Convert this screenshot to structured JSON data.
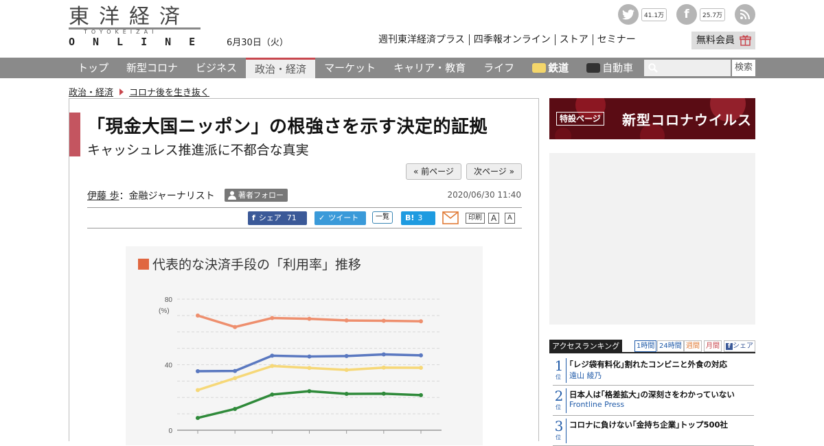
{
  "brand": {
    "logo_kanji": "東洋経済",
    "logo_sub": "TOYOKEIZAI",
    "logo_online": "ONLINE",
    "accent": "#c8474e"
  },
  "header": {
    "date": "6月30日（火）",
    "links": [
      "週刊東洋経済プラス",
      "四季報オンライン",
      "ストア",
      "セミナー"
    ],
    "member_label": "無料会員",
    "social": [
      {
        "icon": "twitter-icon",
        "count": "41.1万"
      },
      {
        "icon": "facebook-icon",
        "count": "25.7万"
      },
      {
        "icon": "rss-icon",
        "count": ""
      }
    ]
  },
  "nav": {
    "items": [
      "トップ",
      "新型コロナ",
      "ビジネス",
      "政治・経済",
      "マーケット",
      "キャリア・教育",
      "ライフ",
      "鉄道",
      "自動車"
    ],
    "active_index": 3,
    "search_placeholder": "",
    "search_button": "検索"
  },
  "breadcrumb": [
    "政治・経済",
    "コロナ後を生き抜く"
  ],
  "article": {
    "title": "「現金大国ニッポン」の根強さを示す決定的証拠",
    "subtitle": "キャッシュレス推進派に不都合な真実",
    "prev_page": "« 前ページ",
    "next_page": "次ページ »",
    "author_name": "伊藤 歩",
    "author_role": "：金融ジャーナリスト",
    "follow_label": "著者フォロー",
    "date": "2020/06/30 11:40",
    "share": {
      "facebook_label": "シェア",
      "facebook_count": "71",
      "tweet_label": "ツイート",
      "list_label": "一覧",
      "hatena_label": "B!",
      "hatena_count": "3",
      "print_label": "印刷",
      "font_large": "A",
      "font_small": "A"
    }
  },
  "chart_data": {
    "type": "line",
    "title": "代表的な決済手段の「利用率」推移",
    "ylabel": "(%)",
    "ylim": [
      0,
      80
    ],
    "yticks": [
      0,
      40,
      80
    ],
    "x_count": 7,
    "grid": true,
    "series": [
      {
        "color": "#ee8f6e",
        "values": [
          70,
          63,
          68.5,
          68,
          67,
          66.8,
          66.5
        ]
      },
      {
        "color": "#5a78c0",
        "values": [
          36,
          36.2,
          45.5,
          45,
          45.3,
          46.3,
          45.7
        ]
      },
      {
        "color": "#f6d878",
        "values": [
          24.5,
          31.8,
          39.2,
          38,
          36.8,
          38.2,
          38.1
        ]
      },
      {
        "color": "#2f8a3a",
        "values": [
          7.5,
          13,
          21.8,
          23.8,
          22.2,
          22.3,
          21.4
        ]
      }
    ]
  },
  "sidebar": {
    "banner_tag": "特設ページ",
    "banner_text": "新型コロナウイルス",
    "ranking_title": "アクセスランキング",
    "ranking_tabs": [
      "1時間",
      "24時間",
      "週間",
      "月間",
      "シェア"
    ],
    "ranking": [
      {
        "rank": "1",
        "suffix": "位",
        "title": "｢レジ袋有料化｣割れたコンビニと外食の対応",
        "author": "遠山 綾乃"
      },
      {
        "rank": "2",
        "suffix": "位",
        "title": "日本人は｢格差拡大｣の深刻さをわかっていない",
        "author": "Frontline Press"
      },
      {
        "rank": "3",
        "suffix": "位",
        "title": "コロナに負けない｢金持ち企業｣トップ500社",
        "author": ""
      }
    ]
  }
}
